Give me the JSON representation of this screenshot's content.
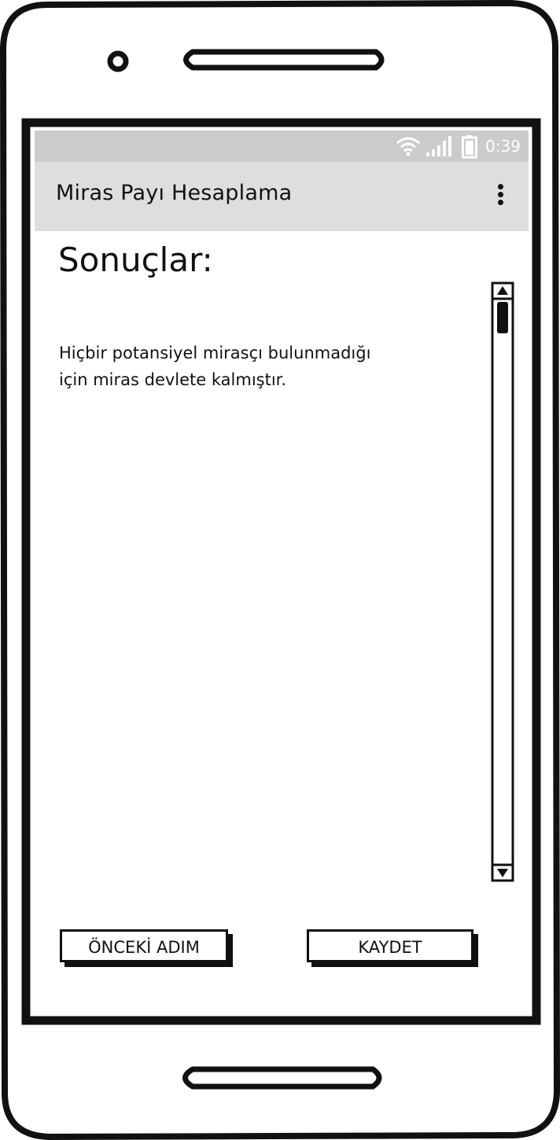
{
  "status_bar": {
    "time": "0:39",
    "icons": [
      "wifi-icon",
      "signal-icon",
      "battery-icon"
    ]
  },
  "app_bar": {
    "title": "Miras Payı Hesaplama",
    "menu_icon": "overflow-menu-icon"
  },
  "main": {
    "heading": "Sonuçlar:",
    "result_line_1": "Hiçbir potansiyel mirasçı bulunmadığı",
    "result_line_2": "için miras devlete kalmıştır."
  },
  "buttons": {
    "previous_label": "ÖNCEKİ ADIM",
    "save_label": "KAYDET"
  },
  "colors": {
    "status_bar": "#cbcbcb",
    "app_bar": "#dedede",
    "ink": "#111111"
  }
}
